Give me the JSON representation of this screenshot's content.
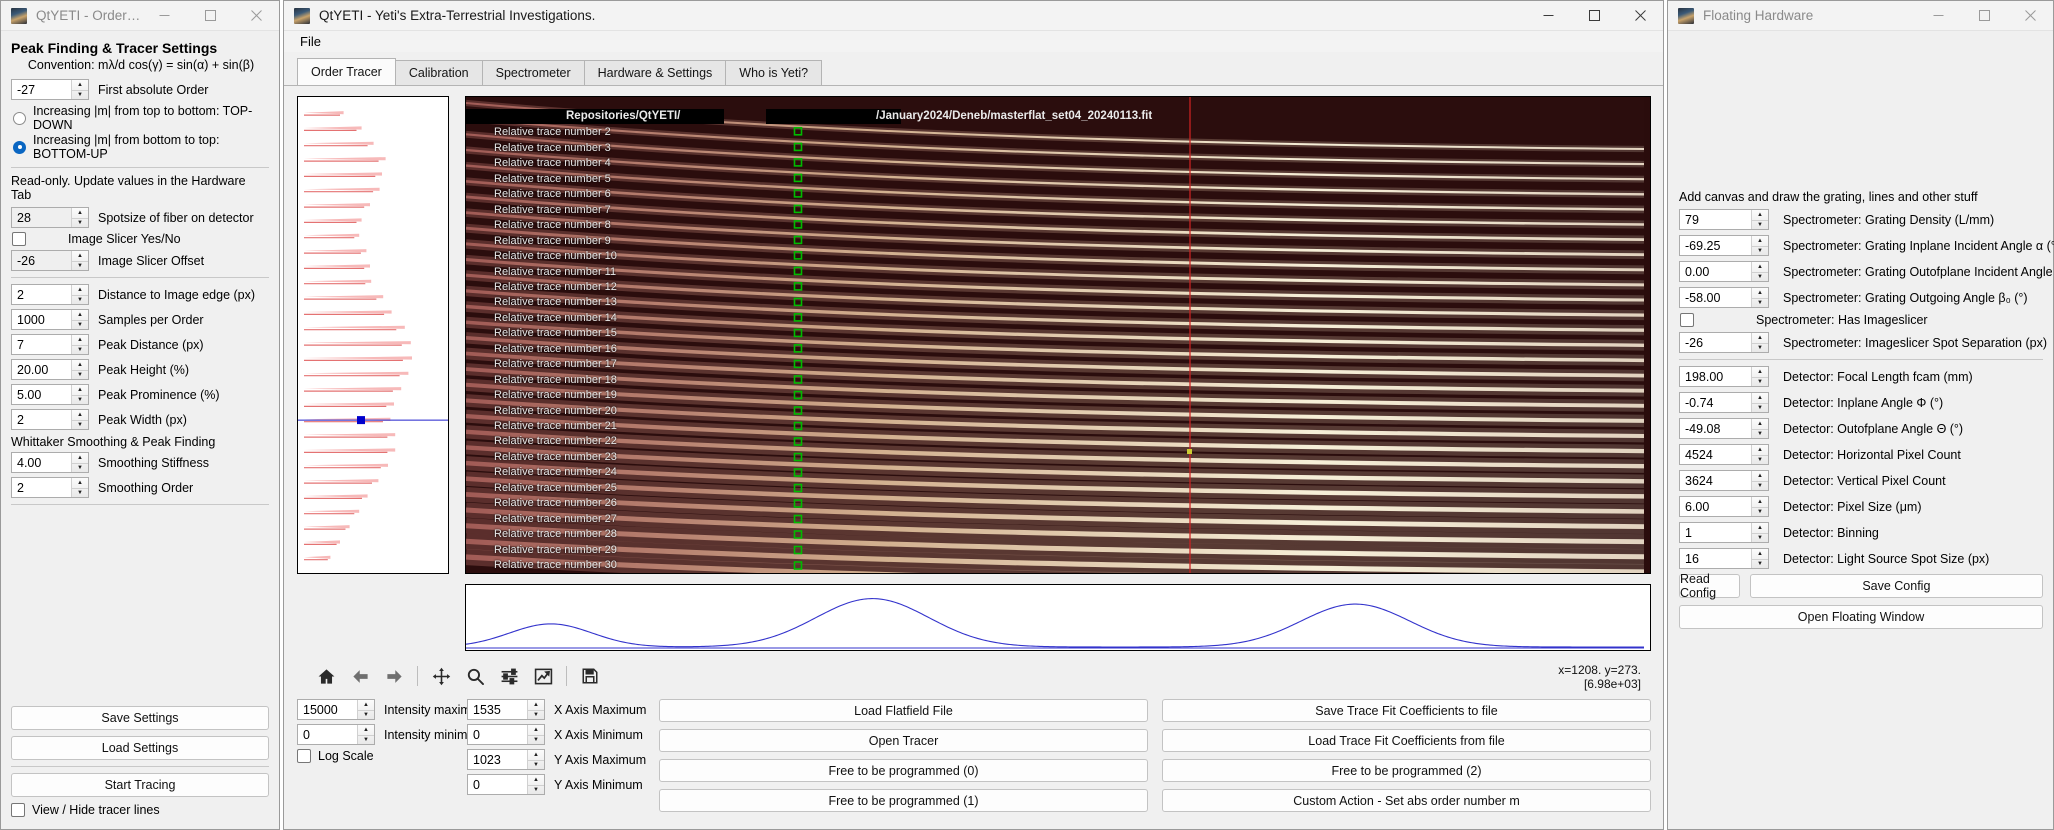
{
  "left_window": {
    "title": "QtYETI - Order Tra...",
    "buttons": {
      "minimize": "minimize",
      "maximize": "maximize"
    },
    "section_title": "Peak Finding & Tracer Settings",
    "convention": "Convention: mλ/d cos(γ) = sin(α) + sin(β)",
    "first_order": {
      "value": "-27",
      "label": "First absolute Order"
    },
    "radio_top_down": {
      "label": "Increasing |m| from top to bottom: TOP-DOWN",
      "selected": false
    },
    "radio_bottom_up": {
      "label": "Increasing |m| from bottom to top: BOTTOM-UP",
      "selected": true
    },
    "readonly_hint": "Read-only. Update values in the Hardware Tab",
    "spotsize": {
      "value": "28",
      "label": "Spotsize of fiber on detector"
    },
    "image_slicer": {
      "label": "Image Slicer Yes/No",
      "checked": false
    },
    "slicer_offset": {
      "value": "-26",
      "label": "Image Slicer Offset"
    },
    "dist_edge": {
      "value": "2",
      "label": "Distance to Image edge (px)"
    },
    "samples": {
      "value": "1000",
      "label": "Samples per Order"
    },
    "peak_distance": {
      "value": "7",
      "label": "Peak Distance (px)"
    },
    "peak_height": {
      "value": "20.00",
      "label": "Peak Height (%)"
    },
    "peak_prominence": {
      "value": "5.00",
      "label": "Peak Prominence (%)"
    },
    "peak_width": {
      "value": "2",
      "label": "Peak Width (px)"
    },
    "whittaker_title": "Whittaker Smoothing & Peak Finding",
    "smoothing_stiffness": {
      "value": "4.00",
      "label": "Smoothing Stiffness"
    },
    "smoothing_order": {
      "value": "2",
      "label": "Smoothing Order"
    },
    "save_settings": "Save Settings",
    "load_settings": "Load Settings",
    "start_tracing": "Start Tracing",
    "view_hide_tracer": {
      "label": "View / Hide tracer lines",
      "checked": false
    }
  },
  "main_window": {
    "title": "QtYETI - Yeti's Extra-Terrestrial Investigations.",
    "menu": [
      "File"
    ],
    "tabs": [
      {
        "label": "Order Tracer",
        "active": true
      },
      {
        "label": "Calibration",
        "active": false
      },
      {
        "label": "Spectrometer",
        "active": false
      },
      {
        "label": "Hardware & Settings",
        "active": false
      },
      {
        "label": "Who is Yeti?",
        "active": false
      }
    ],
    "filepath": "Repositories/QtYETI/",
    "filepath2": "/January2024/Deneb/masterflat_set04_20240113.fit",
    "trace_label_prefix": "Relative trace number",
    "trace_count": 30,
    "coordinates": {
      "line1": "x=1208. y=273.",
      "line2": "[6.98e+03]"
    },
    "toolbar_icons": [
      "home-icon",
      "back-arrow-icon",
      "forward-arrow-icon",
      "pan-icon",
      "zoom-icon",
      "subplot-config-icon",
      "edit-curve-icon",
      "save-icon"
    ],
    "intensity_max": {
      "value": "15000",
      "label": "Intensity maximum"
    },
    "intensity_min": {
      "value": "0",
      "label": "Intensity minimum"
    },
    "log_scale": {
      "label": "Log Scale",
      "checked": false
    },
    "x_axis_max": {
      "value": "1535",
      "label": "X Axis Maximum"
    },
    "x_axis_min": {
      "value": "0",
      "label": "X Axis Minimum"
    },
    "y_axis_max": {
      "value": "1023",
      "label": "Y Axis Maximum"
    },
    "y_axis_min": {
      "value": "0",
      "label": "Y Axis Minimum"
    },
    "action_buttons_left": [
      "Load Flatfield File",
      "Open Tracer",
      "Free to be programmed (0)",
      "Free to be programmed (1)"
    ],
    "action_buttons_right": [
      "Save Trace Fit Coefficients to file",
      "Load Trace Fit Coefficients from file",
      "Free to be programmed (2)",
      "Custom Action - Set abs order number m"
    ]
  },
  "right_window": {
    "title": "Floating Hardware",
    "canvas_hint": "Add canvas and draw the grating, lines and other stuff",
    "fields": [
      {
        "value": "79",
        "label": "Spectrometer: Grating Density (L/mm)",
        "type": "spin"
      },
      {
        "value": "-69.25",
        "label": "Spectrometer: Grating Inplane Incident Angle α (°)",
        "type": "spin"
      },
      {
        "value": "0.00",
        "label": "Spectrometer: Grating Outofplane Incident Angle γ (°)",
        "type": "spin"
      },
      {
        "value": "-58.00",
        "label": "Spectrometer: Grating Outgoing Angle β₀ (°)",
        "type": "spin"
      },
      {
        "value": "",
        "label": "Spectrometer: Has Imageslicer",
        "type": "check"
      },
      {
        "value": "-26",
        "label": "Spectrometer: Imageslicer Spot Separation (px)",
        "type": "spin"
      },
      {
        "value": "198.00",
        "label": "Detector: Focal Length fcam (mm)",
        "type": "spin",
        "divider_before": true
      },
      {
        "value": "-0.74",
        "label": "Detector: Inplane Angle Φ (°)",
        "type": "spin"
      },
      {
        "value": "-49.08",
        "label": "Detector: Outofplane Angle Θ (°)",
        "type": "spin"
      },
      {
        "value": "4524",
        "label": "Detector: Horizontal Pixel Count",
        "type": "spin"
      },
      {
        "value": "3624",
        "label": "Detector: Vertical Pixel Count",
        "type": "spin"
      },
      {
        "value": "6.00",
        "label": "Detector: Pixel Size (μm)",
        "type": "spin"
      },
      {
        "value": "1",
        "label": "Detector: Binning",
        "type": "spin"
      },
      {
        "value": "16",
        "label": "Detector: Light Source Spot Size (px)",
        "type": "spin"
      }
    ],
    "read_config": "Read Config",
    "save_config": "Save Config",
    "open_floating": "Open Floating Window"
  },
  "chart_data": [
    {
      "type": "line",
      "name": "order-peak-profile-sidebar",
      "title": "",
      "orientation": "horizontal",
      "xlabel": "",
      "ylabel": "",
      "cursor_marker": {
        "x": 0.42,
        "y": 0.685,
        "color": "#0000cc"
      },
      "horizontal_cursor_line_y": 0.685,
      "peak_lengths": [
        0.33,
        0.48,
        0.58,
        0.68,
        0.65,
        0.63,
        0.55,
        0.48,
        0.46,
        0.52,
        0.55,
        0.56,
        0.66,
        0.73,
        0.84,
        0.89,
        0.9,
        0.87,
        0.81,
        0.75,
        0.72,
        0.76,
        0.76,
        0.7,
        0.62,
        0.53,
        0.46,
        0.38,
        0.3,
        0.22
      ],
      "color": "#f08080"
    },
    {
      "type": "heatmap",
      "name": "echelle-order-image",
      "title": "",
      "xlim": [
        0,
        1535
      ],
      "ylim": [
        0,
        1023
      ],
      "traces": 30,
      "trace_label_prefix": "Relative trace number",
      "marker_color": "#00bb00",
      "cursor_line_color": "#cc2222",
      "background": "#2b0d0d"
    },
    {
      "type": "line",
      "name": "cross-section-spectrum",
      "title": "",
      "xlabel": "",
      "ylabel": "",
      "color": "#3333cc",
      "peaks": [
        {
          "center": 0.072,
          "height": 0.42,
          "width": 0.035
        },
        {
          "center": 0.345,
          "height": 0.88,
          "width": 0.048
        },
        {
          "center": 0.755,
          "height": 0.78,
          "width": 0.046
        }
      ]
    }
  ]
}
